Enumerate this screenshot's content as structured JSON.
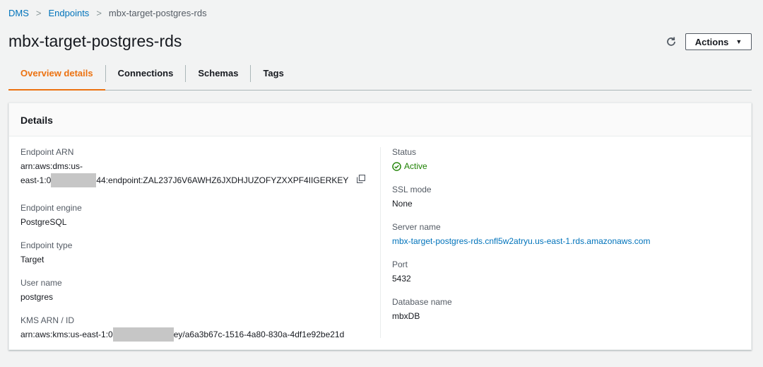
{
  "breadcrumb": {
    "items": [
      "DMS",
      "Endpoints"
    ],
    "current": "mbx-target-postgres-rds"
  },
  "page": {
    "title": "mbx-target-postgres-rds"
  },
  "toolbar": {
    "actions_label": "Actions"
  },
  "tabs": [
    "Overview details",
    "Connections",
    "Schemas",
    "Tags"
  ],
  "details": {
    "header": "Details",
    "endpoint_arn": {
      "label": "Endpoint ARN",
      "line1": "arn:aws:dms:us-",
      "line2_prefix": "east-1:0",
      "line2_suffix": "44:endpoint:ZAL237J6V6AWHZ6JXDHJUZOFYZXXPF4IIGERKEY"
    },
    "endpoint_engine": {
      "label": "Endpoint engine",
      "value": "PostgreSQL"
    },
    "endpoint_type": {
      "label": "Endpoint type",
      "value": "Target"
    },
    "user_name": {
      "label": "User name",
      "value": "postgres"
    },
    "kms_arn": {
      "label": "KMS ARN / ID",
      "prefix": "arn:aws:kms:us-east-1:0",
      "suffix": "ey/a6a3b67c-1516-4a80-830a-4df1e92be21d"
    },
    "status": {
      "label": "Status",
      "value": "Active"
    },
    "ssl_mode": {
      "label": "SSL mode",
      "value": "None"
    },
    "server_name": {
      "label": "Server name",
      "value": "mbx-target-postgres-rds.cnfl5w2atryu.us-east-1.rds.amazonaws.com"
    },
    "port": {
      "label": "Port",
      "value": "5432"
    },
    "database_name": {
      "label": "Database name",
      "value": "mbxDB"
    }
  },
  "colors": {
    "link": "#0073bb",
    "active_tab": "#ec7211",
    "status_success": "#1d8102",
    "redaction": "#c6c6c6"
  }
}
